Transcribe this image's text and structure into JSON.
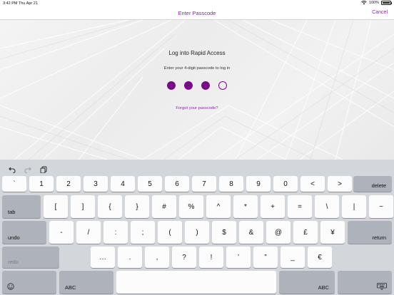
{
  "status_bar": {
    "time": "3:42 PM",
    "date": "Thu Apr 21",
    "battery": "100%"
  },
  "nav": {
    "title": "Enter Passcode",
    "cancel": "Cancel"
  },
  "content": {
    "title": "Log into Rapid Access",
    "subtitle": "Enter your 4-digit passcode to log in",
    "passcode_filled": 3,
    "passcode_length": 4,
    "forgot": "Forgot your passcode?",
    "accent_color": "#7a0a87"
  },
  "keyboard": {
    "toolbar": [
      "undo-arrow-icon",
      "redo-arrow-icon",
      "clipboard-icon"
    ],
    "row1": [
      "`",
      "1",
      "2",
      "3",
      "4",
      "5",
      "6",
      "7",
      "8",
      "9",
      "0",
      "<",
      ">"
    ],
    "row1_end": "delete",
    "row2_start": "tab",
    "row2": [
      "[",
      "]",
      "{",
      "}",
      "#",
      "%",
      "^",
      "*",
      "+",
      "=",
      "\\",
      "|",
      "~"
    ],
    "row3_start": "undo",
    "row3": [
      "-",
      "/",
      ":",
      ";",
      "(",
      ")",
      "$",
      "&",
      "@",
      "£",
      "¥"
    ],
    "row3_end": "return",
    "row4_start": "redo",
    "row4": [
      "…",
      ".",
      ",",
      "?",
      "!",
      "’",
      "”",
      "_",
      "€"
    ],
    "row5_left": "ABC",
    "row5_right": "ABC",
    "globe_icon": "emoji-icon",
    "hide_icon": "keyboard-hide-icon"
  }
}
